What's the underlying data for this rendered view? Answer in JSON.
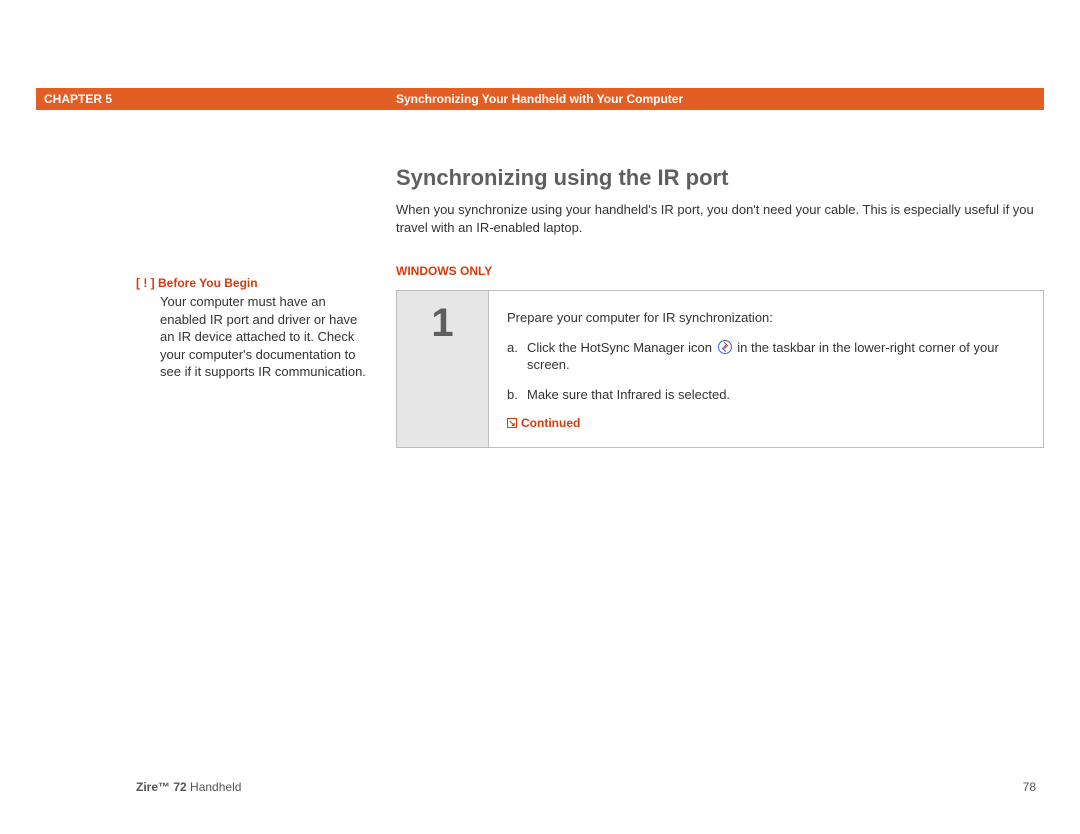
{
  "header": {
    "chapter": "CHAPTER 5",
    "title": "Synchronizing Your Handheld with Your Computer"
  },
  "section": {
    "title": "Synchronizing using the IR port",
    "intro": "When you synchronize using your handheld's IR port, you don't need your cable. This is especially useful if you travel with an IR-enabled laptop.",
    "windows_only": "WINDOWS ONLY"
  },
  "sidebar": {
    "marker": "[ ! ]",
    "heading": "Before You Begin",
    "body": "Your computer must have an enabled IR port and driver or have an IR device attached to it. Check your computer's documentation to see if it supports IR communication."
  },
  "step": {
    "number": "1",
    "intro": "Prepare your computer for IR synchronization:",
    "items": [
      {
        "marker": "a.",
        "pre": "Click the HotSync Manager icon",
        "post": "in the taskbar in the lower-right corner of your screen."
      },
      {
        "marker": "b.",
        "pre": "Make sure that Infrared is selected.",
        "post": ""
      }
    ],
    "continued": "Continued"
  },
  "footer": {
    "product_bold": "Zire™ 72",
    "product_rest": " Handheld",
    "page": "78"
  }
}
